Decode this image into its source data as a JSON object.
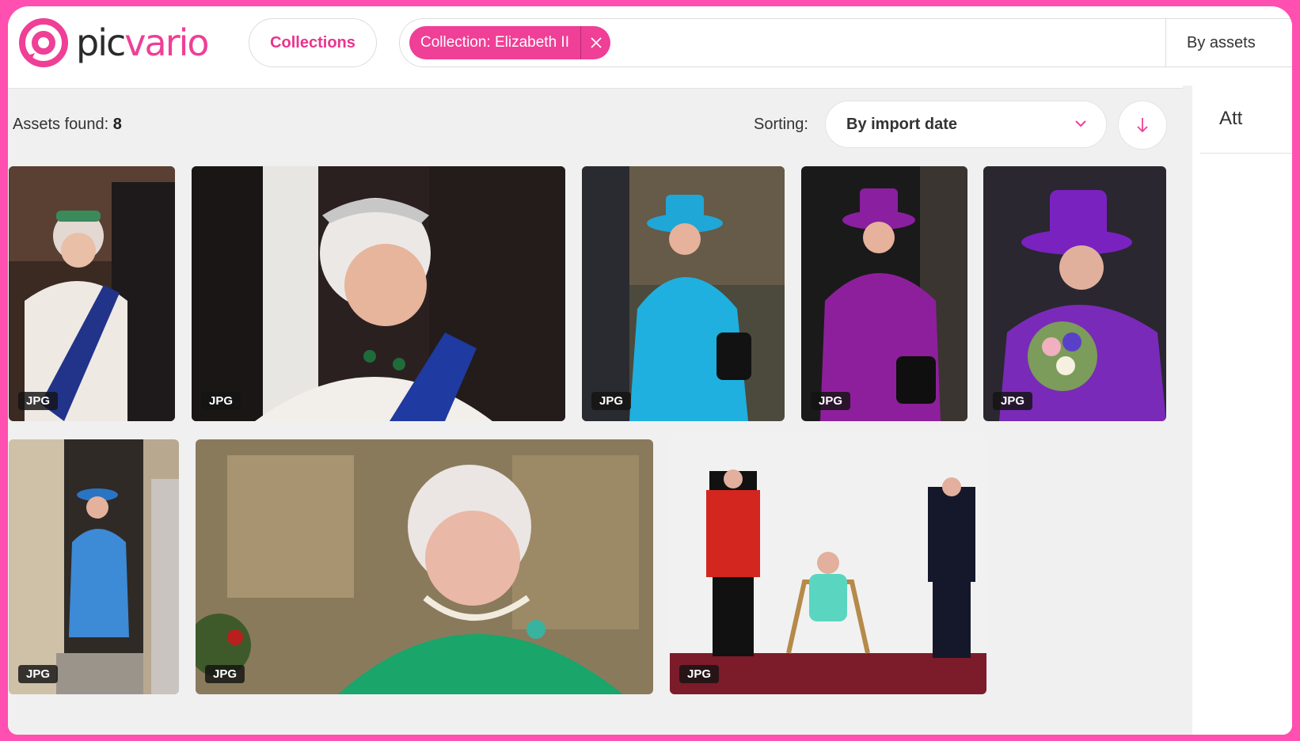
{
  "header": {
    "logo_text_1": "pic",
    "logo_text_2": "vario",
    "collections_label": "Collections",
    "filter_chip_label": "Collection: Elizabeth II",
    "view_mode_label": "By assets"
  },
  "toolbar": {
    "assets_found_label": "Assets found:",
    "assets_found_count": "8",
    "sorting_label": "Sorting:",
    "sorting_value": "By import date"
  },
  "right_panel": {
    "tab_label": "Att"
  },
  "assets": [
    {
      "format": "JPG",
      "description": "tiara and blue sash"
    },
    {
      "format": "JPG",
      "description": "emerald tiara close up"
    },
    {
      "format": "JPG",
      "description": "turquoise coat"
    },
    {
      "format": "JPG",
      "description": "purple coat"
    },
    {
      "format": "JPG",
      "description": "purple hat with bouquet"
    },
    {
      "format": "JPG",
      "description": "blue coat at doorway"
    },
    {
      "format": "JPG",
      "description": "green dress portrait"
    },
    {
      "format": "JPG",
      "description": "seated between two officers"
    }
  ],
  "colors": {
    "accent": "#ef3f96",
    "frame": "#ff4fb0"
  }
}
